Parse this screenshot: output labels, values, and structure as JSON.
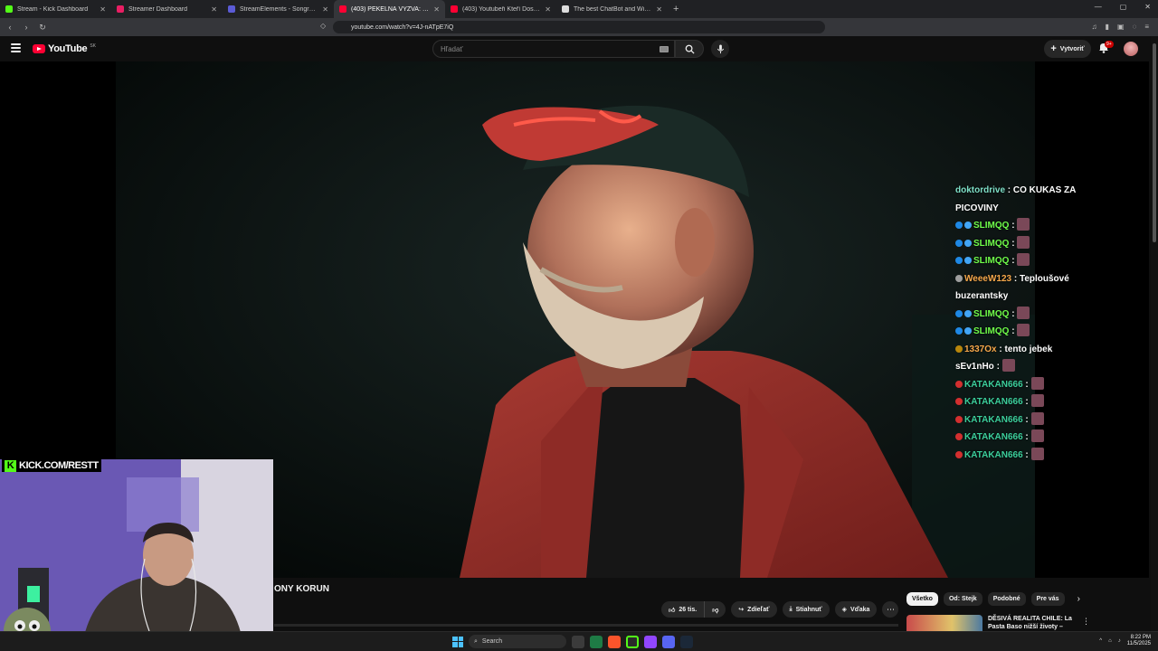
{
  "browser": {
    "tabs": [
      {
        "label": "Stream - Kick Dashboard",
        "color": "#53fc18",
        "active": false
      },
      {
        "label": "Streamer Dashboard",
        "color": "#e91e63",
        "active": false
      },
      {
        "label": "StreamElements - Songrequest",
        "color": "#5b5bd6",
        "active": false
      },
      {
        "label": "(403) PEKELNÁ VÝZVA: 20 Y...",
        "color": "#ff0033",
        "active": true
      },
      {
        "label": "(403) Youtubeři Kteří Dostali Ban (a P...",
        "color": "#ff0033",
        "active": false
      },
      {
        "label": "The best ChatBot and Widgets for Ki...",
        "color": "#dddddd",
        "active": false
      }
    ],
    "url": "youtube.com/watch?v=4J-nATpE7iQ"
  },
  "youtube": {
    "logo_text": "YouTube",
    "country_code": "SK",
    "search_placeholder": "Hľadať",
    "create_label": "Vytvoriť",
    "notif_badge": "9+",
    "video_title": "ONY KORUN",
    "likes": "26 tis.",
    "share_label": "Zdieľať",
    "download_label": "Stiahnuť",
    "thanks_label": "Vďaka",
    "chips": [
      "Všetko",
      "Od: Stejk",
      "Podobné",
      "Pre vás"
    ],
    "reco_title": "DĚSIVÁ REALITA CHILE: La Pasta Baso nižší životy – Vohna"
  },
  "overlay": {
    "kick_banner": "KICK.COM/RESTT",
    "chat": [
      {
        "user": "doktordrive",
        "text": "CO KUKAS ZA PICOVINY",
        "color": "u-teal",
        "badges": [],
        "emote": false
      },
      {
        "user": "SLIMQQ",
        "text": "",
        "color": "u-lime",
        "badges": [
          "#1e88e5",
          "#42a5f5"
        ],
        "emote": true
      },
      {
        "user": "SLIMQQ",
        "text": "",
        "color": "u-lime",
        "badges": [
          "#1e88e5",
          "#42a5f5"
        ],
        "emote": true
      },
      {
        "user": "SLIMQQ",
        "text": "",
        "color": "u-lime",
        "badges": [
          "#1e88e5",
          "#42a5f5"
        ],
        "emote": true
      },
      {
        "user": "WeeeW123",
        "text": "Teploušové buzerantsky",
        "color": "u-orange",
        "badges": [
          "#9e9e9e"
        ],
        "emote": false
      },
      {
        "user": "SLIMQQ",
        "text": "",
        "color": "u-lime",
        "badges": [
          "#1e88e5",
          "#42a5f5"
        ],
        "emote": true
      },
      {
        "user": "SLIMQQ",
        "text": "",
        "color": "u-lime",
        "badges": [
          "#1e88e5",
          "#42a5f5"
        ],
        "emote": true
      },
      {
        "user": "1337Ox",
        "text": "tento jebek",
        "color": "u-orange",
        "badges": [
          "#b8860b"
        ],
        "emote": false
      },
      {
        "user": "sEv1nHo",
        "text": "",
        "color": "u-white",
        "badges": [],
        "emote": true
      },
      {
        "user": "KATAKAN666",
        "text": "",
        "color": "u-kat",
        "badges": [
          "#d32f2f"
        ],
        "emote": true
      },
      {
        "user": "KATAKAN666",
        "text": "",
        "color": "u-kat",
        "badges": [
          "#d32f2f"
        ],
        "emote": true
      },
      {
        "user": "KATAKAN666",
        "text": "",
        "color": "u-kat",
        "badges": [
          "#d32f2f"
        ],
        "emote": true
      },
      {
        "user": "KATAKAN666",
        "text": "",
        "color": "u-kat",
        "badges": [
          "#d32f2f"
        ],
        "emote": true
      },
      {
        "user": "KATAKAN666",
        "text": "",
        "color": "u-kat",
        "badges": [
          "#d32f2f"
        ],
        "emote": true
      }
    ]
  },
  "taskbar": {
    "search_label": "Search",
    "time": "8:22 PM",
    "date": "11/5/2025"
  }
}
